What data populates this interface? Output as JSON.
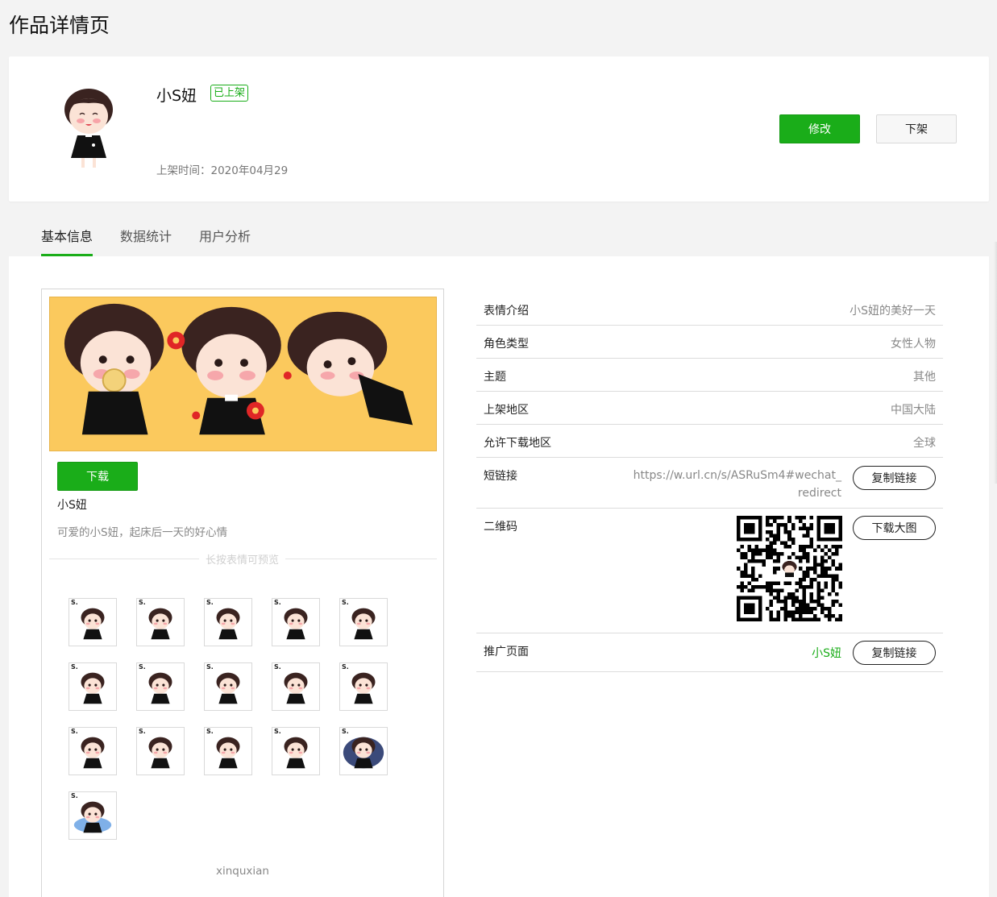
{
  "page": {
    "title": "作品详情页"
  },
  "work": {
    "name": "小S妞",
    "status": "已上架",
    "publish_time": "上架时间：2020年04月29",
    "edit_label": "修改",
    "offshelf_label": "下架"
  },
  "tabs": [
    {
      "label": "基本信息",
      "active": true
    },
    {
      "label": "数据统计",
      "active": false
    },
    {
      "label": "用户分析",
      "active": false
    }
  ],
  "preview": {
    "download_label": "下载",
    "name": "小S妞",
    "description": "可爱的小S妞，起床后一天的好心情",
    "divider_text": "长按表情可预览",
    "author": "xinquxian",
    "stickers": [
      "S.",
      "S.",
      "S.",
      "S.",
      "S.",
      "S.",
      "S.",
      "S.",
      "S.",
      "S.",
      "S.",
      "S.",
      "S.",
      "S.",
      "S.",
      "S."
    ]
  },
  "info": {
    "rows": [
      {
        "label": "表情介绍",
        "value": "小S妞的美好一天"
      },
      {
        "label": "角色类型",
        "value": "女性人物"
      },
      {
        "label": "主题",
        "value": "其他"
      },
      {
        "label": "上架地区",
        "value": "中国大陆"
      },
      {
        "label": "允许下载地区",
        "value": "全球"
      }
    ],
    "short_link": {
      "label": "短链接",
      "value": "https://w.url.cn/s/ASRuSm4#wechat_redirect",
      "button": "复制链接"
    },
    "qr_code": {
      "label": "二维码",
      "button": "下载大图"
    },
    "promo_page": {
      "label": "推广页面",
      "value": "小S妞",
      "button": "复制链接"
    }
  },
  "colors": {
    "accent": "#1aad19",
    "banner": "#fbc95d"
  }
}
